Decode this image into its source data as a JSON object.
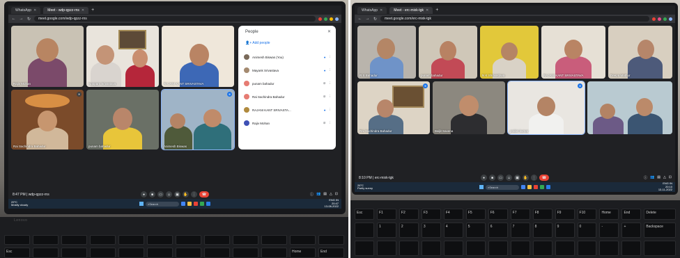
{
  "left": {
    "tabs": [
      {
        "label": "WhatsApp",
        "active": false
      },
      {
        "label": "Meet - wdp-qpzz-rns",
        "active": true
      }
    ],
    "url": "meet.google.com/wdp-qpzz-rns",
    "participants": [
      {
        "name": "Rajiv Mohan"
      },
      {
        "name": "Noopam Srivastava"
      },
      {
        "name": "RAJANI KANT SRIVASTAVA"
      },
      {
        "name": "Rai Sachindra Bahadur"
      },
      {
        "name": "punam bahadur"
      },
      {
        "name": "Animesh Biswas"
      }
    ],
    "people_panel": {
      "title": "People",
      "add_label": "Add people",
      "rows": [
        {
          "name": "Animesh Biswas (You)",
          "subtitle": "Meeting host"
        },
        {
          "name": "Mayank Srivastava"
        },
        {
          "name": "punam bahadur"
        },
        {
          "name": "Rai Sachindra Bahadur"
        },
        {
          "name": "RAJANI KANT SRIVASTA..."
        },
        {
          "name": "Rajiv Mohan"
        }
      ]
    },
    "meeting_time": "8:47 PM  |  wdp-qpzz-rns",
    "weather": {
      "temp": "29°C",
      "desc": "Mostly cloudy"
    },
    "search_label": "Search",
    "clock": {
      "time": "20:47",
      "date": "13-08-2022",
      "lang": "ENG IN"
    }
  },
  "right": {
    "tabs": [
      {
        "label": "WhatsApp",
        "active": false
      },
      {
        "label": "Meet - erc-mixk-tgk",
        "active": true
      }
    ],
    "url": "meet.google.com/erc-mixk-tgk",
    "participants": [
      {
        "name": "R S Bahadur"
      },
      {
        "name": "punam bahadur"
      },
      {
        "name": "N K Shrivastava"
      },
      {
        "name": "RAJANI KANT SRIVASTAVA"
      },
      {
        "name": "Deepa Mathur"
      },
      {
        "name": "Rai Sachindra Bahadur"
      },
      {
        "name": "Baljit Saxena"
      },
      {
        "name": "prabin kumar"
      },
      {
        "name": ""
      }
    ],
    "meeting_time": "8:10 PM  |  erc-mixk-tgk",
    "weather": {
      "temp": "26°C",
      "desc": "Partly sunny"
    },
    "search_label": "Search",
    "clock": {
      "time": "20:10",
      "date": "13-11-2022",
      "lang": "ENG IN"
    }
  },
  "keyboard_labels": {
    "esc": "Esc",
    "f1": "F1",
    "f2": "F2",
    "f3": "F3",
    "f4": "F4",
    "f5": "F5",
    "f6": "F6",
    "f7": "F7",
    "f8": "F8",
    "f9": "F9",
    "f10": "F10",
    "home": "Home",
    "end": "End",
    "insert": "Insert",
    "delete": "Delete",
    "num1": "1",
    "num2": "2",
    "num3": "3",
    "num4": "4",
    "num5": "5",
    "num6": "6",
    "num7": "7",
    "num8": "8",
    "num9": "9",
    "num0": "0",
    "minus": "-",
    "plus": "+",
    "backspace": "Backspace"
  }
}
